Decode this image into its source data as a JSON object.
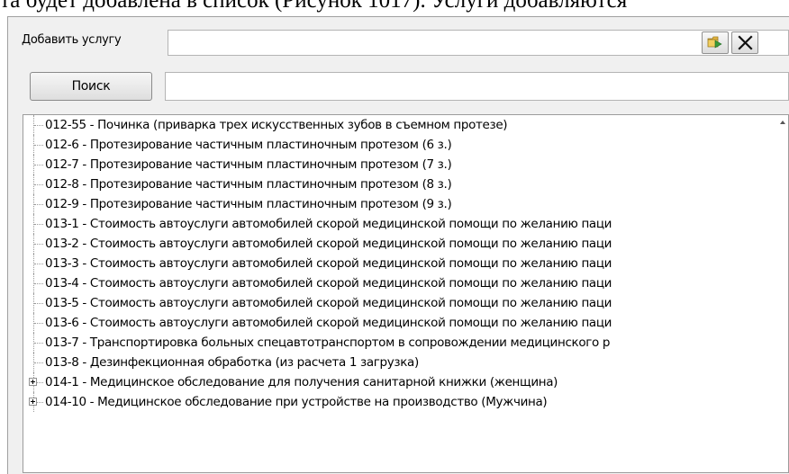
{
  "doc_text": "та будет добавлена в список (Рисунок 1017). Услуги добавляются",
  "form": {
    "add_label": "Добавить услугу",
    "add_value": "",
    "search_button": "Поиск",
    "search_value": ""
  },
  "icons": {
    "open": "folder-open-icon",
    "clear": "close-icon"
  },
  "tree_items": [
    {
      "label": "012-55 - Починка (приварка трех искусственных зубов  в съемном протезе)",
      "expandable": false
    },
    {
      "label": "012-6 - Протезирование частичным пластиночным протезом (6 з.)",
      "expandable": false
    },
    {
      "label": "012-7 - Протезирование частичным пластиночным протезом (7 з.)",
      "expandable": false
    },
    {
      "label": "012-8 - Протезирование частичным пластиночным протезом (8 з.)",
      "expandable": false
    },
    {
      "label": "012-9 - Протезирование частичным пластиночным протезом (9 з.)",
      "expandable": false
    },
    {
      "label": "013-1 - Стоимость автоуслуги автомобилей скорой медицинской помощи по желанию паци",
      "expandable": false
    },
    {
      "label": "013-2 - Стоимость автоуслуги автомобилей скорой медицинской помощи по желанию паци",
      "expandable": false
    },
    {
      "label": "013-3 - Стоимость автоуслуги автомобилей скорой медицинской помощи по желанию паци",
      "expandable": false
    },
    {
      "label": "013-4 - Стоимость автоуслуги автомобилей скорой медицинской помощи по желанию паци",
      "expandable": false
    },
    {
      "label": "013-5 - Стоимость автоуслуги автомобилей скорой медицинской помощи по желанию паци",
      "expandable": false
    },
    {
      "label": "013-6 - Стоимость автоуслуги автомобилей скорой медицинской помощи по желанию паци",
      "expandable": false
    },
    {
      "label": "013-7 - Транспортировка больных спецавтотранспортом в сопровождении медицинского р",
      "expandable": false
    },
    {
      "label": "013-8 - Дезинфекционная обработка (из расчета 1 загрузка)",
      "expandable": false
    },
    {
      "label": "014-1 - Медицинское обследование для получения санитарной книжки (женщина)",
      "expandable": true
    },
    {
      "label": "014-10 - Медицинское обследование при устройстве на производство (Мужчина)",
      "expandable": true
    }
  ]
}
